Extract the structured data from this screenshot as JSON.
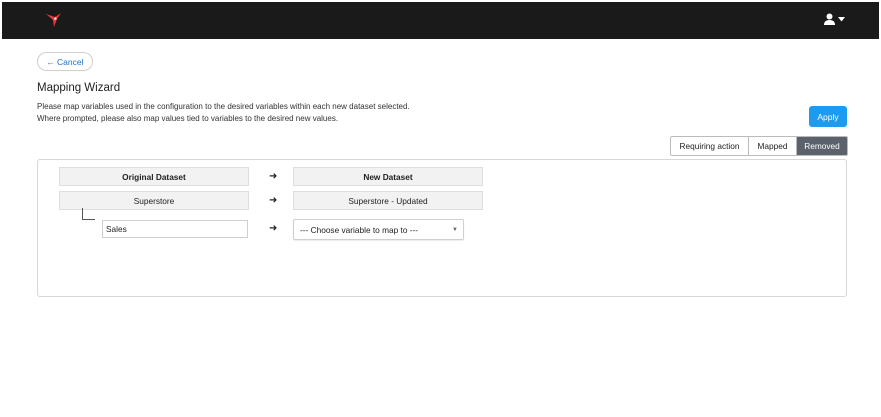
{
  "header": {
    "logo_icon": "hummingbird-logo-icon",
    "user_icon": "user-icon",
    "menu_icon": "caret-down-icon"
  },
  "nav": {
    "cancel_label": "Cancel",
    "cancel_icon": "arrow-left-icon",
    "cancel_glyph": "←"
  },
  "page": {
    "title": "Mapping Wizard",
    "description_line1": "Please map variables used in the configuration to the desired variables within each new dataset selected.",
    "description_line2": "Where prompted, please also map values tied to variables to the desired new values.",
    "apply_label": "Apply"
  },
  "filters": {
    "options": [
      "Requiring action",
      "Mapped",
      "Removed"
    ],
    "selected": "Removed"
  },
  "mapping": {
    "header": {
      "original": "Original Dataset",
      "new": "New Dataset"
    },
    "arrow_glyph": "➜",
    "dataset_row": {
      "original": "Superstore",
      "new": "Superstore - Updated"
    },
    "variable_row": {
      "variable": "Sales",
      "placeholder": "--- Choose variable to map to ---"
    }
  },
  "colors": {
    "accent": "#1d9bf0",
    "topbar": "#1a1a1a",
    "selected_filter": "#5b626b",
    "link": "#1a73c8"
  }
}
